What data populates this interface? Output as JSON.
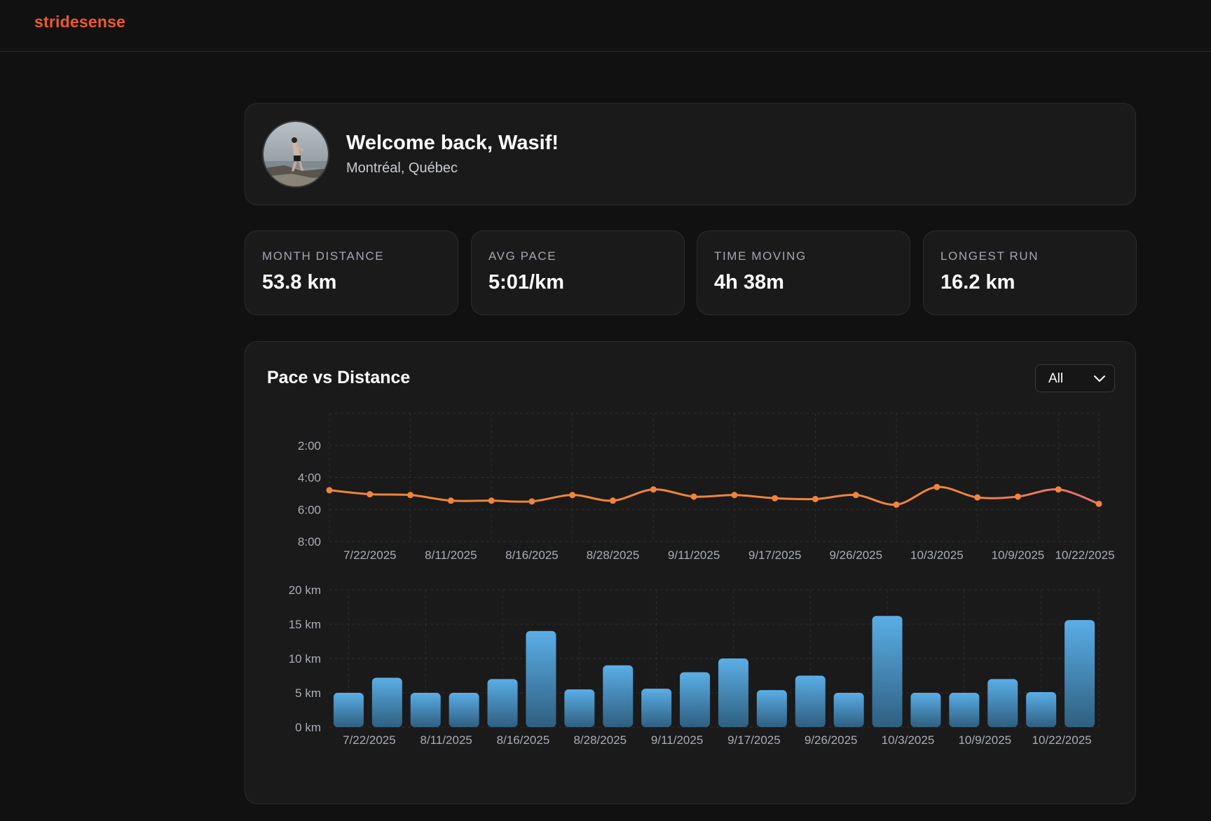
{
  "brand": "stridesense",
  "welcome": {
    "title": "Welcome back, Wasif!",
    "location": "Montréal, Québec"
  },
  "stats": [
    {
      "label": "MONTH DISTANCE",
      "value": "53.8 km"
    },
    {
      "label": "AVG PACE",
      "value": "5:01/km"
    },
    {
      "label": "TIME MOVING",
      "value": "4h 38m"
    },
    {
      "label": "LONGEST RUN",
      "value": "16.2 km"
    }
  ],
  "chart_panel": {
    "title": "Pace vs Distance",
    "filter": {
      "selected": "All",
      "icon": "chevron-down-icon"
    }
  },
  "colors": {
    "brand": "#ee5a2b",
    "pace_line": "#f0843a",
    "pace_line_end": "#e8707a",
    "bar_top": "#5aaee6",
    "bar_bottom": "#2f5f80"
  },
  "chart_data": [
    {
      "type": "line",
      "title": "",
      "xlabel": "",
      "ylabel": "",
      "y_unit": "min/km",
      "y_tick_labels": [
        "2:00",
        "4:00",
        "6:00",
        "8:00"
      ],
      "y_ticks": [
        2,
        4,
        6,
        8
      ],
      "ylim": [
        0,
        8
      ],
      "y_inverted": true,
      "x_tick_labels": [
        "7/22/2025",
        "8/11/2025",
        "8/16/2025",
        "8/28/2025",
        "9/11/2025",
        "9/17/2025",
        "9/26/2025",
        "10/3/2025",
        "10/9/2025",
        "10/22/2025"
      ],
      "grid": true,
      "values": [
        4.8,
        5.05,
        5.1,
        5.45,
        5.45,
        5.5,
        5.1,
        5.45,
        4.75,
        5.2,
        5.1,
        5.3,
        5.35,
        5.1,
        5.7,
        4.6,
        5.25,
        5.2,
        4.75,
        5.65
      ]
    },
    {
      "type": "bar",
      "title": "",
      "xlabel": "",
      "ylabel": "",
      "y_unit": "km",
      "y_tick_labels": [
        "0 km",
        "5 km",
        "10 km",
        "15 km",
        "20 km"
      ],
      "y_ticks": [
        0,
        5,
        10,
        15,
        20
      ],
      "ylim": [
        0,
        20
      ],
      "x_tick_labels": [
        "7/22/2025",
        "8/11/2025",
        "8/16/2025",
        "8/28/2025",
        "9/11/2025",
        "9/17/2025",
        "9/26/2025",
        "10/3/2025",
        "10/9/2025",
        "10/22/2025"
      ],
      "grid": true,
      "values": [
        5.0,
        7.2,
        5.0,
        5.0,
        7.0,
        14.0,
        5.5,
        9.0,
        5.6,
        8.0,
        10.0,
        5.4,
        7.5,
        5.0,
        16.2,
        5.0,
        5.0,
        7.0,
        5.1,
        15.6
      ]
    }
  ]
}
